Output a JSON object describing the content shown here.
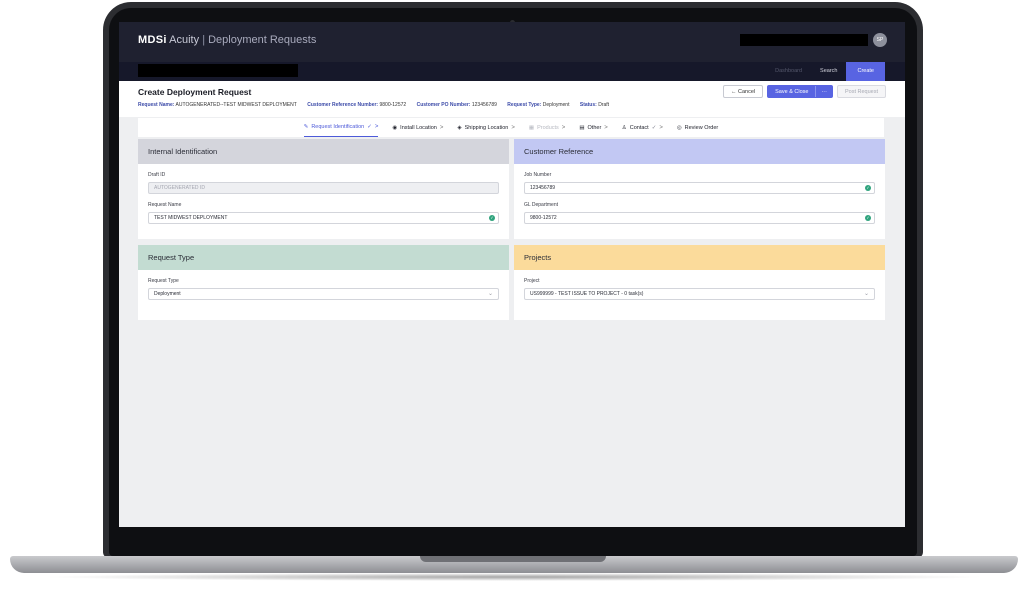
{
  "app": {
    "logo": "MDSi",
    "product": "Acuity",
    "separator": "|",
    "module": "Deployment Requests",
    "avatar_initials": "SP"
  },
  "nav": {
    "links": [
      "Dashboard",
      "Search",
      "Create"
    ]
  },
  "header": {
    "title": "Create Deployment Request",
    "meta": [
      {
        "key": "Request Name:",
        "value": "AUTOGENERATED--TEST MIDWEST DEPLOYMENT"
      },
      {
        "key": "Customer Reference Number:",
        "value": "9800-12572"
      },
      {
        "key": "Customer PO Number:",
        "value": "123456789"
      },
      {
        "key": "Request Type:",
        "value": "Deployment"
      },
      {
        "key": "Status:",
        "value": "Draft"
      }
    ],
    "buttons": {
      "cancel": "Cancel",
      "save_close": "Save & Close",
      "more": "···",
      "post": "Post Request"
    }
  },
  "steps": [
    {
      "label": "Request Identification",
      "icon": "edit-icon",
      "icon_char": "✎",
      "check": "✓",
      "arrow": ">"
    },
    {
      "label": "Install Location",
      "icon": "pin-icon",
      "icon_char": "◉",
      "arrow": ">"
    },
    {
      "label": "Shipping Location",
      "icon": "truck-icon",
      "icon_char": "◈",
      "arrow": ">"
    },
    {
      "label": "Products",
      "icon": "grid-icon",
      "icon_char": "▦",
      "arrow": ">"
    },
    {
      "label": "Other",
      "icon": "note-icon",
      "icon_char": "▤",
      "arrow": ">"
    },
    {
      "label": "Contact",
      "icon": "person-icon",
      "icon_char": "♙",
      "check": "✓",
      "arrow": ">"
    },
    {
      "label": "Review Order",
      "icon": "eye-icon",
      "icon_char": "◎"
    }
  ],
  "panels": {
    "internal": {
      "title": "Internal Identification",
      "color": "#d4d5dc",
      "draft_label": "Draft ID",
      "draft_value": "AUTOGENERATED ID",
      "name_label": "Request Name",
      "name_value": "TEST MIDWEST DEPLOYMENT"
    },
    "customer": {
      "title": "Customer Reference",
      "color": "#c2c8f3",
      "job_label": "Job Number",
      "job_value": "123456789",
      "gl_label": "GL Department",
      "gl_value": "9800-12572"
    },
    "type": {
      "title": "Request Type",
      "color": "#c3dcd2",
      "type_label": "Request Type",
      "type_value": "Deployment"
    },
    "projects": {
      "title": "Projects",
      "color": "#fbdb9b",
      "project_label": "Project",
      "project_value": "US999999 - TEST ISSUE TO PROJECT - 0 task(s)"
    }
  }
}
